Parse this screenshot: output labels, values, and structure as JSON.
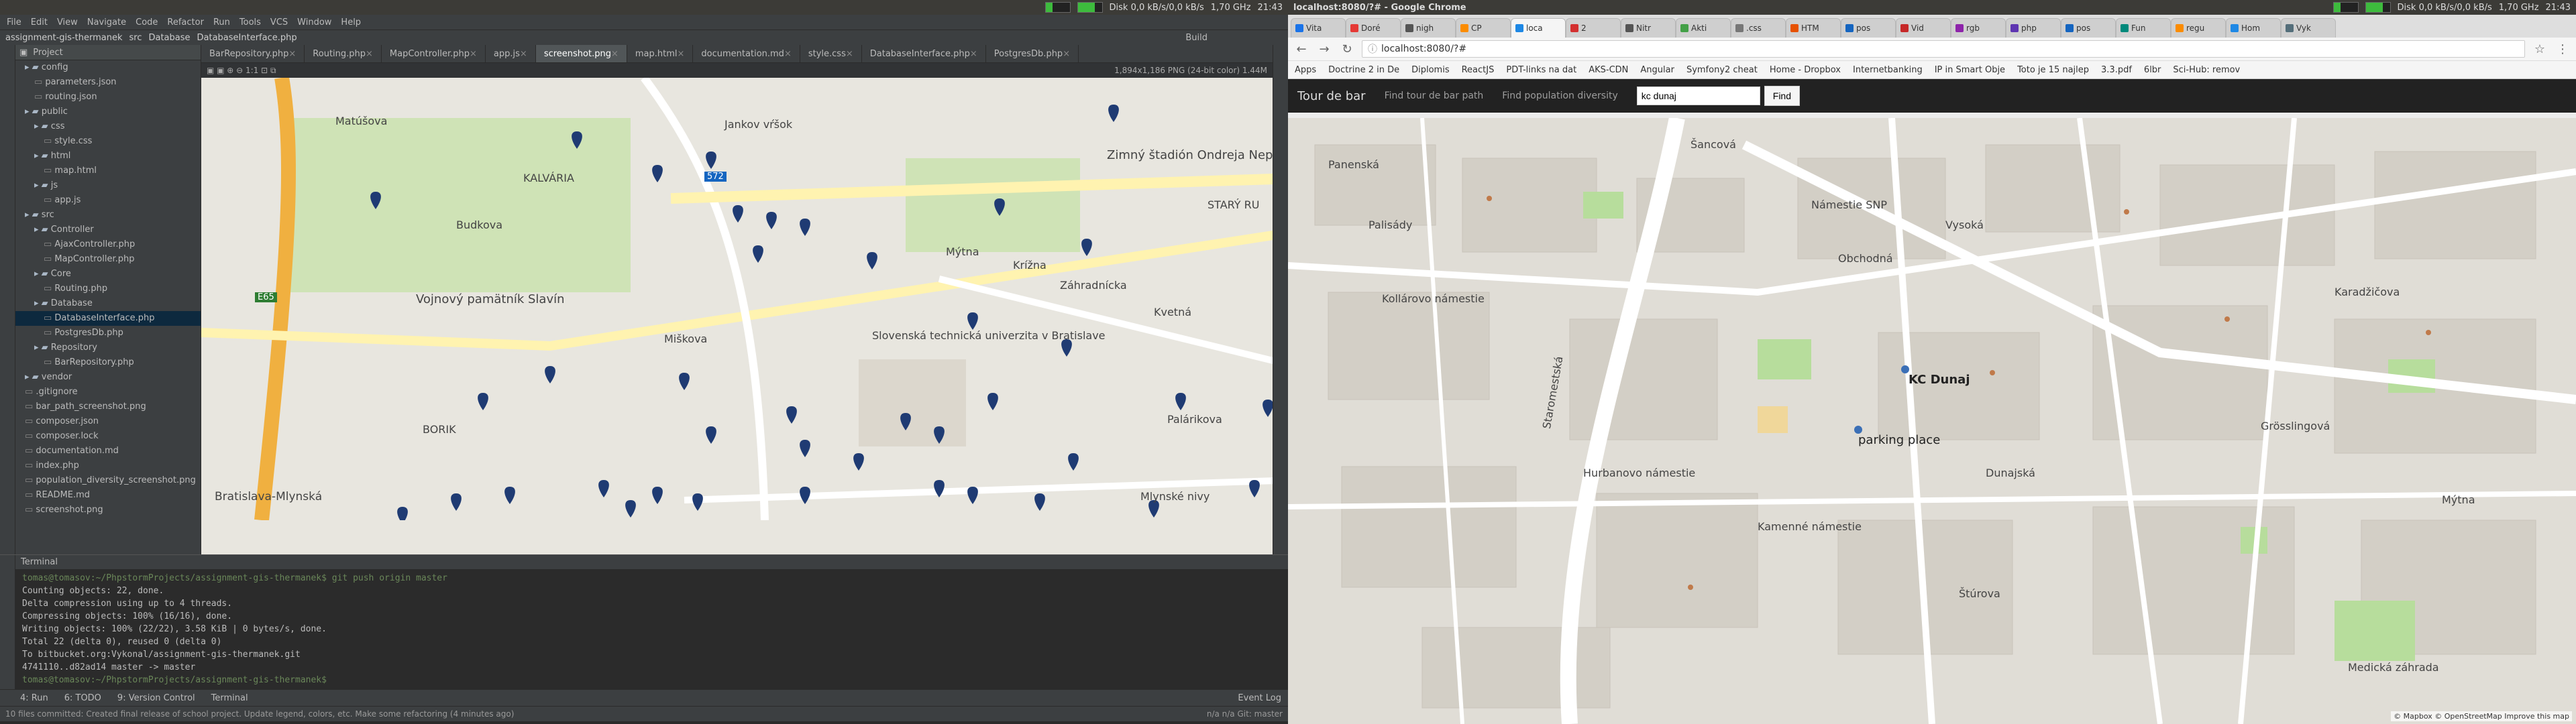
{
  "system": {
    "left_title": "",
    "right_title": "localhost:8080/?# - Google Chrome",
    "disk": "Disk 0,0 kB/s/0,0 kB/s",
    "cpu": "1,70 GHz",
    "time": "21:43",
    "colors": {
      "meter": "#3dbb3d"
    }
  },
  "ide": {
    "menu": [
      "File",
      "Edit",
      "View",
      "Navigate",
      "Code",
      "Refactor",
      "Run",
      "Tools",
      "VCS",
      "Window",
      "Help"
    ],
    "breadcrumb": [
      "assignment-gis-thermanek",
      "src",
      "Database",
      "DatabaseInterface.php"
    ],
    "build_label": "Build",
    "project_label": "Project",
    "tree": [
      {
        "label": "config",
        "type": "folder"
      },
      {
        "label": "parameters.json",
        "type": "file"
      },
      {
        "label": "routing.json",
        "type": "file"
      },
      {
        "label": "public",
        "type": "folder"
      },
      {
        "label": "css",
        "type": "folder"
      },
      {
        "label": "style.css",
        "type": "file"
      },
      {
        "label": "html",
        "type": "folder"
      },
      {
        "label": "map.html",
        "type": "file"
      },
      {
        "label": "js",
        "type": "folder"
      },
      {
        "label": "app.js",
        "type": "file"
      },
      {
        "label": "src",
        "type": "folder"
      },
      {
        "label": "Controller",
        "type": "folder"
      },
      {
        "label": "AjaxController.php",
        "type": "file"
      },
      {
        "label": "MapController.php",
        "type": "file"
      },
      {
        "label": "Core",
        "type": "folder"
      },
      {
        "label": "Routing.php",
        "type": "file"
      },
      {
        "label": "Database",
        "type": "folder"
      },
      {
        "label": "DatabaseInterface.php",
        "type": "file",
        "selected": true
      },
      {
        "label": "PostgresDb.php",
        "type": "file"
      },
      {
        "label": "Repository",
        "type": "folder"
      },
      {
        "label": "BarRepository.php",
        "type": "file"
      },
      {
        "label": "vendor",
        "type": "folder"
      },
      {
        "label": ".gitignore",
        "type": "file"
      },
      {
        "label": "bar_path_screenshot.png",
        "type": "file"
      },
      {
        "label": "composer.json",
        "type": "file"
      },
      {
        "label": "composer.lock",
        "type": "file"
      },
      {
        "label": "documentation.md",
        "type": "file"
      },
      {
        "label": "index.php",
        "type": "file"
      },
      {
        "label": "population_diversity_screenshot.png",
        "type": "file"
      },
      {
        "label": "README.md",
        "type": "file"
      },
      {
        "label": "screenshot.png",
        "type": "file"
      }
    ],
    "tabs": [
      {
        "label": "BarRepository.php",
        "active": false
      },
      {
        "label": "Routing.php",
        "active": false
      },
      {
        "label": "MapController.php",
        "active": false
      },
      {
        "label": "app.js",
        "active": false
      },
      {
        "label": "screenshot.png",
        "active": true
      },
      {
        "label": "map.html",
        "active": false
      },
      {
        "label": "documentation.md",
        "active": false
      },
      {
        "label": "style.css",
        "active": false
      },
      {
        "label": "DatabaseInterface.php",
        "active": false
      },
      {
        "label": "PostgresDb.php",
        "active": false
      }
    ],
    "image_info": "1,894x1,186 PNG (24-bit color) 1.44M",
    "map_labels": [
      "Matúšova",
      "Zimný štadión Ondreja Nepelu",
      "KALVÁRIA",
      "STARÝ RU",
      "Vojnový pamätník Slavín",
      "Slovenská technická univerzita v Bratislave",
      "Záhradnícka",
      "BORIK",
      "Bratislava-Mlynská",
      "Mlynské nivy",
      "Krížna",
      "Kvetná",
      "Palárikova",
      "Mýtna",
      "Budkova",
      "Miškova",
      "Jankov vŕšok",
      "E65",
      "572"
    ],
    "terminal": {
      "label": "Terminal",
      "lines": [
        "tomas@tomasov:~/PhpstormProjects/assignment-gis-thermanek$ git push origin master",
        "Counting objects: 22, done.",
        "Delta compression using up to 4 threads.",
        "Compressing objects: 100% (16/16), done.",
        "Writing objects: 100% (22/22), 3.58 KiB | 0 bytes/s, done.",
        "Total 22 (delta 0), reused 0 (delta 0)",
        "To bitbucket.org:Vykonal/assignment-gis-thermanek.git",
        "   4741110..d82ad14  master -> master",
        "tomas@tomasov:~/PhpstormProjects/assignment-gis-thermanek$"
      ]
    },
    "bottom_tools": [
      "4: Run",
      "6: TODO",
      "9: Version Control",
      "Terminal",
      "Event Log"
    ],
    "status": "10 files committed: Created final release of school project. Update legend, colors, etc. Make some refactoring (4 minutes ago)",
    "status_right": "n/a   n/a   Git: master"
  },
  "chrome": {
    "tabs": [
      "Vita",
      "Doré",
      "nigh",
      "CP",
      "loca",
      "2",
      "Nitr",
      "Akti",
      ".css",
      "HTM",
      "pos",
      "Vid",
      "rgb",
      "php",
      "pos",
      "Fun",
      "regu",
      "Hom",
      "Vyk"
    ],
    "active_tab": 4,
    "url": "localhost:8080/?#",
    "bookmarks": [
      "Apps",
      "Doctrine 2 in De",
      "Diplomis",
      "ReactJS",
      "PDT-links na dat",
      "AKS-CDN",
      "Angular",
      "Symfony2 cheat",
      "Home - Dropbox",
      "Internetbanking",
      "IP in Smart Obje",
      "Toto je 15 najlep",
      "3.3.pdf",
      "6lbr",
      "Sci-Hub: remov"
    ],
    "nav": {
      "brand": "Tour de bar",
      "link1": "Find tour de bar path",
      "link2": "Find population diversity",
      "search_value": "kc dunaj",
      "button": "Find"
    },
    "map_labels": [
      "KC Dunaj",
      "parking place",
      "Staromestská",
      "Palisády",
      "Hurbanovo námestie",
      "Obchodná",
      "Vysoká",
      "Kamenné námestie",
      "Námestie SNP",
      "Dunajská",
      "Grösslingová",
      "Panenská",
      "Štúrova",
      "Medická záhrada",
      "Šancová",
      "Karadžičova",
      "Mýtna",
      "Kollárovo námestie"
    ],
    "attribution": "© Mapbox © OpenStreetMap Improve this map"
  }
}
